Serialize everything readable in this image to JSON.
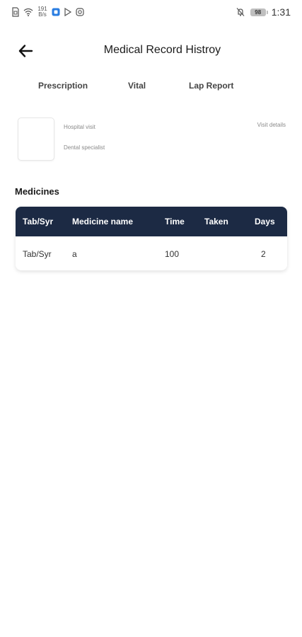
{
  "status_bar": {
    "network_speed_value": "191",
    "network_speed_unit": "B/s",
    "battery": "98",
    "time": "1:31"
  },
  "app_bar": {
    "title": "Medical Record Histroy"
  },
  "tabs": [
    {
      "label": "Prescription"
    },
    {
      "label": "Vital"
    },
    {
      "label": "Lap Report"
    }
  ],
  "visit": {
    "type": "Hospital visit",
    "specialist": "Dental specialist",
    "details_link": "Visit details"
  },
  "medicines": {
    "title": "Medicines",
    "columns": [
      "Tab/Syr",
      "Medicine name",
      "Time",
      "Taken",
      "Days"
    ],
    "rows": [
      [
        "Tab/Syr",
        "a",
        "100",
        "",
        "2"
      ]
    ]
  },
  "colors": {
    "table_header_bg": "#1c2a44",
    "background": "#ffffff"
  }
}
